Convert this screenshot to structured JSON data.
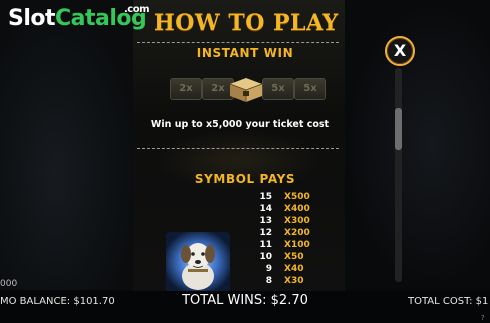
{
  "watermark": {
    "slot": "Slot",
    "catalog": "Catalog",
    "com": ".com"
  },
  "page": {
    "title": "HOW TO PLAY"
  },
  "instant_win": {
    "heading": "INSTANT WIN",
    "multipliers": [
      "2x",
      "2x",
      "5x",
      "5x"
    ],
    "description": "Win up to x5,000 your ticket cost"
  },
  "symbol_pays": {
    "heading": "SYMBOL PAYS",
    "rows": [
      {
        "count": "15",
        "pay": "X500"
      },
      {
        "count": "14",
        "pay": "X400"
      },
      {
        "count": "13",
        "pay": "X300"
      },
      {
        "count": "12",
        "pay": "X200"
      },
      {
        "count": "11",
        "pay": "X100"
      },
      {
        "count": "10",
        "pay": "X50"
      },
      {
        "count": "9",
        "pay": "X40"
      },
      {
        "count": "8",
        "pay": "X30"
      }
    ]
  },
  "footer": {
    "left_number": "000",
    "balance": "MO BALANCE: $101.70",
    "total_wins": "TOTAL WINS: $2.70",
    "total_cost": "TOTAL COST: $1"
  },
  "close_label": "X",
  "corner_mark": "?",
  "colors": {
    "gold": "#f5b624",
    "green": "#34c759",
    "panel": "#0d0d0c"
  },
  "icons": [
    "treasure-chest-icon",
    "dog-symbol-icon",
    "close-icon"
  ]
}
